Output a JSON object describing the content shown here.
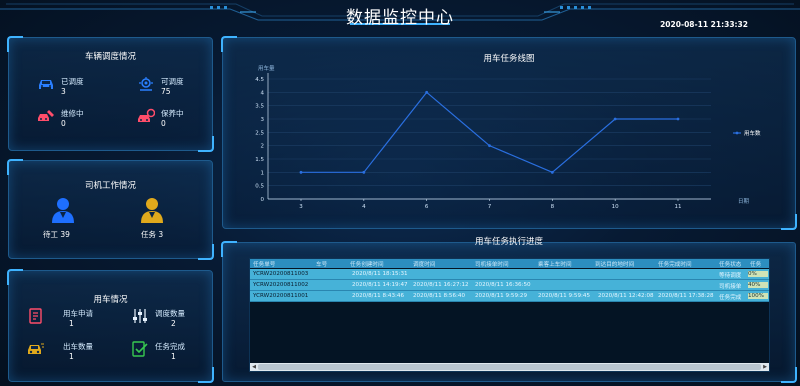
{
  "header": {
    "title": "数据监控中心",
    "datetime": "2020-08-11 21:33:32"
  },
  "vehicle_panel": {
    "title": "车辆调度情况",
    "stats": [
      {
        "label": "已调度",
        "value": "3",
        "icon": "car-icon",
        "color": "#2a7fff"
      },
      {
        "label": "可调度",
        "value": "75",
        "icon": "dispatch-icon",
        "color": "#2a7fff"
      },
      {
        "label": "维修中",
        "value": "0",
        "icon": "repair-icon",
        "color": "#ff4d6a"
      },
      {
        "label": "保养中",
        "value": "0",
        "icon": "maintenance-icon",
        "color": "#ff4d6a"
      }
    ]
  },
  "driver_panel": {
    "title": "司机工作情况",
    "stats": [
      {
        "label": "待工 39",
        "icon": "driver-idle-icon",
        "color": "#1e6fff"
      },
      {
        "label": "任务 3",
        "icon": "driver-busy-icon",
        "color": "#e0a91c"
      }
    ]
  },
  "usage_panel": {
    "title": "用车情况",
    "stats": [
      {
        "label": "用车申请",
        "value": "1",
        "icon": "application-icon",
        "color": "#ff4d6a"
      },
      {
        "label": "调度数量",
        "value": "2",
        "icon": "sliders-icon",
        "color": "#e8f3ff"
      },
      {
        "label": "出车数量",
        "value": "1",
        "icon": "car-out-icon",
        "color": "#e0a91c"
      },
      {
        "label": "任务完成",
        "value": "1",
        "icon": "task-done-icon",
        "color": "#37c850"
      }
    ]
  },
  "line_panel": {
    "title": "用车任务线图"
  },
  "chart_data": {
    "type": "line",
    "title": "用车任务线图",
    "ylabel": "用车量",
    "xlabel": "日期",
    "x": [
      "3",
      "4",
      "6",
      "7",
      "8",
      "10",
      "11"
    ],
    "series": [
      {
        "name": "用车数",
        "values": [
          1,
          1,
          4,
          2,
          1,
          3,
          3
        ],
        "color": "#2a6fe0"
      }
    ],
    "yticks": [
      "0",
      "0.5",
      "1",
      "1.5",
      "2",
      "2.5",
      "3",
      "3.5",
      "4",
      "4.5"
    ],
    "ylim": [
      0,
      4.5
    ],
    "grid": true,
    "legend": "right"
  },
  "table_panel": {
    "title": "用车任务执行进度",
    "columns": [
      "任务单号",
      "车号",
      "任务创建时间",
      "调度时间",
      "司机接单时间",
      "乘客上车时间",
      "到达目的地时间",
      "任务完成时间",
      "任务状态",
      "任务"
    ],
    "rows": [
      {
        "order": "YCRW20200811003",
        "created": "2020/8/11 18:15:31",
        "dispatch": "",
        "accept": "",
        "board": "",
        "arrive": "",
        "finish": "",
        "status": "等待调度",
        "progress": "0%"
      },
      {
        "order": "YCRW20200811002",
        "created": "2020/8/11 14:19:47",
        "dispatch": "2020/8/11 16:27:12",
        "accept": "2020/8/11 16:36:50",
        "board": "",
        "arrive": "",
        "finish": "",
        "status": "司机接单",
        "progress": "40%"
      },
      {
        "order": "YCRW20200811001",
        "created": "2020/8/11 8:43:46",
        "dispatch": "2020/8/11 8:56:40",
        "accept": "2020/8/11 9:59:29",
        "board": "2020/8/11 9:59:45",
        "arrive": "2020/8/11 12:42:08",
        "finish": "2020/8/11 17:38:28",
        "status": "任务完成",
        "progress": "100%"
      }
    ]
  }
}
